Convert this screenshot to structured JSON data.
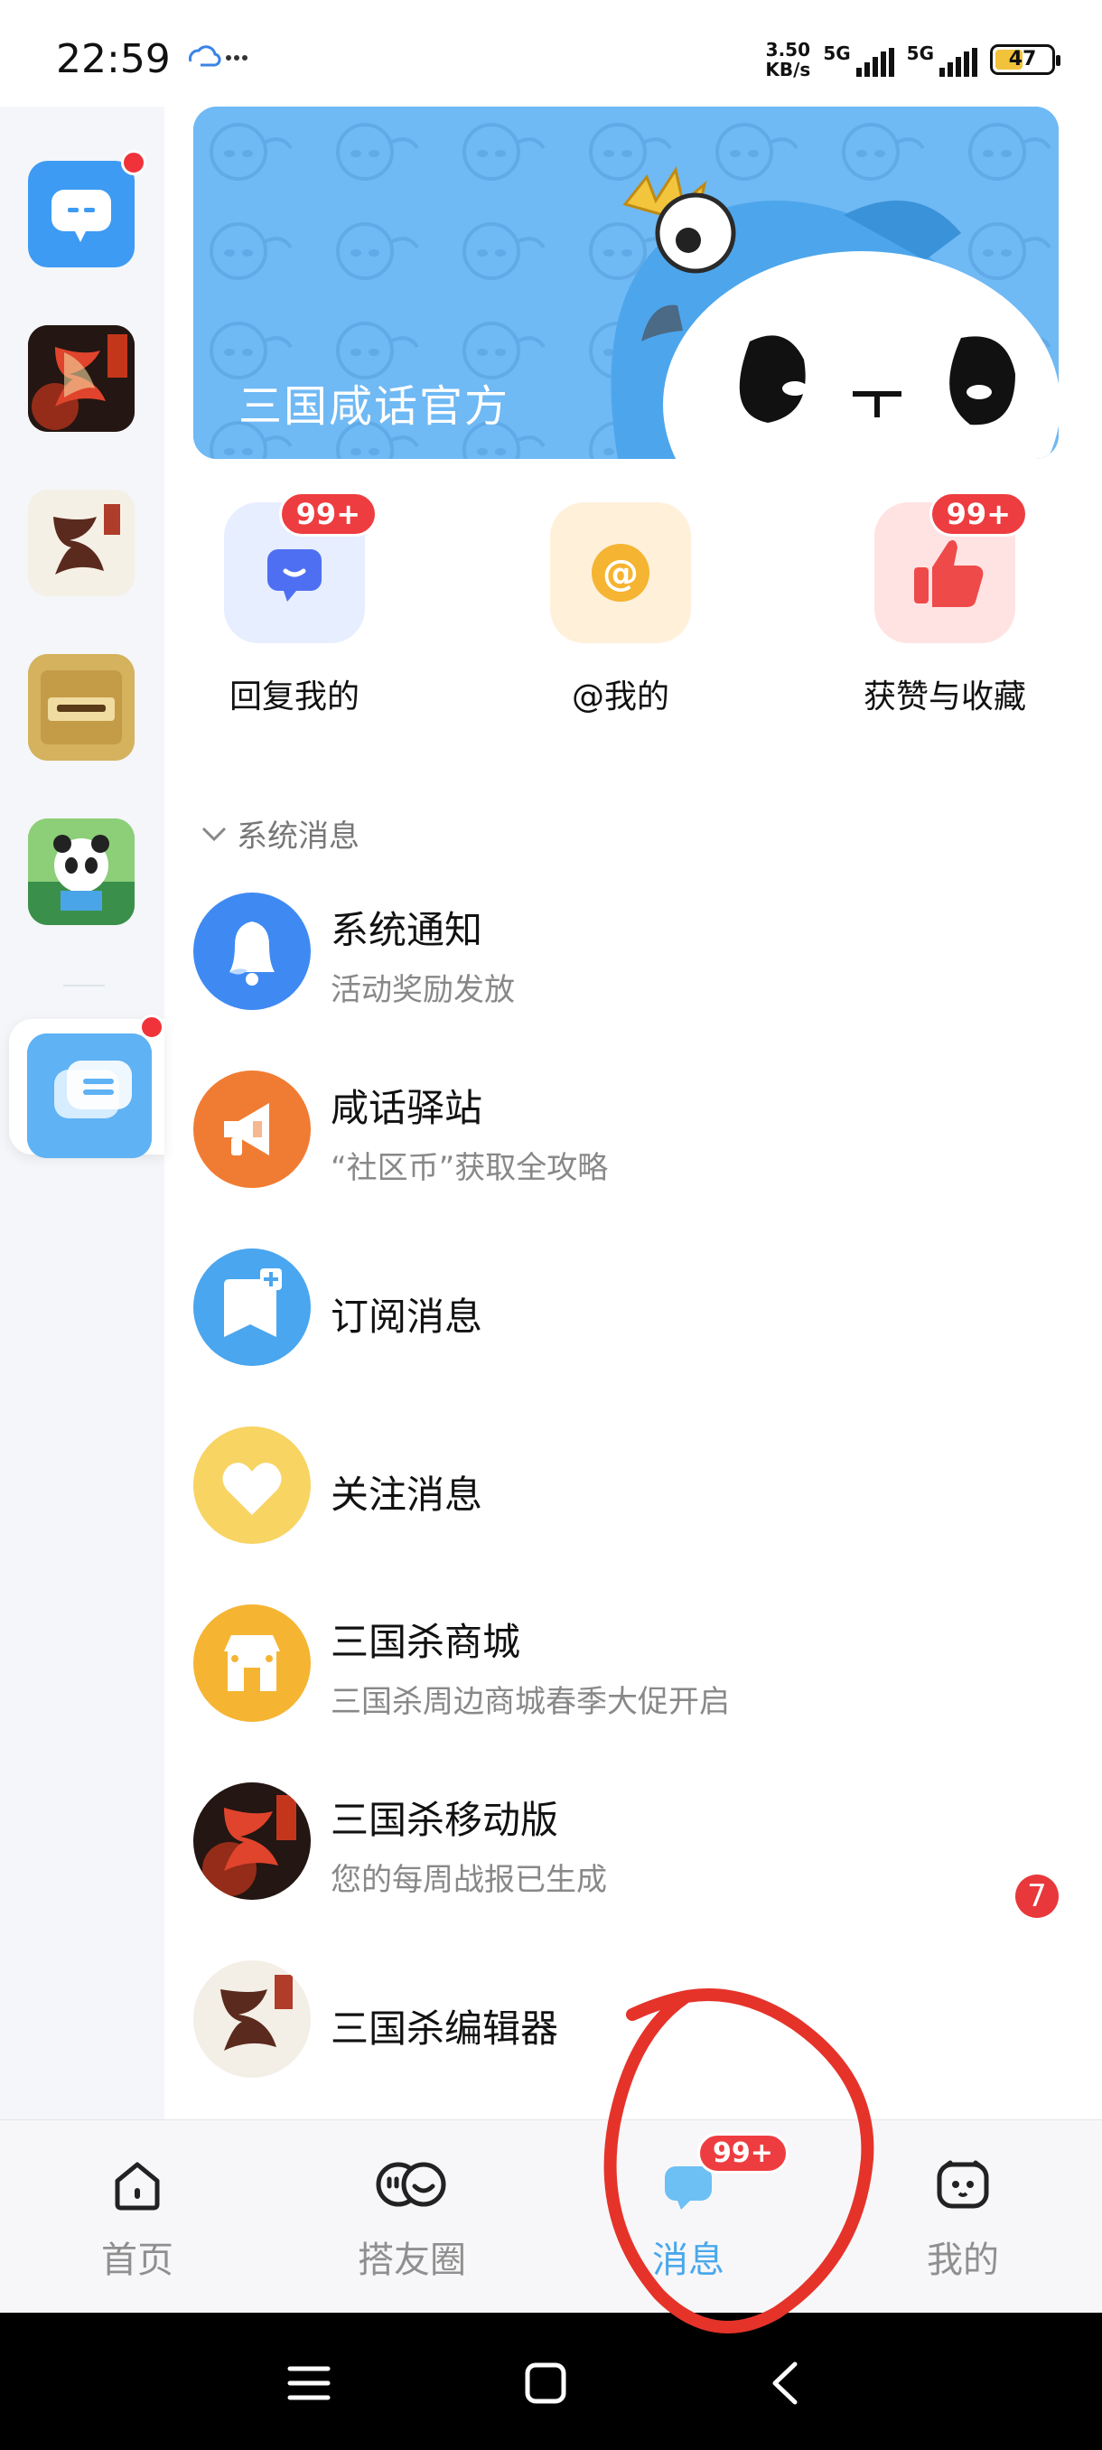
{
  "status_bar": {
    "time": "22:59",
    "speed_value": "3.50",
    "speed_unit": "KB/s",
    "network_1": "5G",
    "network_2": "5G",
    "battery": "47"
  },
  "sidebar": {
    "items": [
      {
        "name": "chat-app",
        "has_dot": true
      },
      {
        "name": "sanguosha-mobile",
        "has_dot": false
      },
      {
        "name": "sanguosha-editor",
        "has_dot": false
      },
      {
        "name": "collection-card",
        "has_dot": false
      },
      {
        "name": "panda-game",
        "has_dot": false
      },
      {
        "name": "messages-bubble",
        "has_dot": true,
        "active": true
      }
    ]
  },
  "banner": {
    "title": "三国咸话官方"
  },
  "quick_actions": [
    {
      "label": "回复我的",
      "badge": "99+",
      "icon": "reply-icon",
      "bg": "#e8efff"
    },
    {
      "label": "@我的",
      "badge": "",
      "icon": "at-icon",
      "bg": "#fff1dc"
    },
    {
      "label": "获赞与收藏",
      "badge": "99+",
      "icon": "thumbs-up-icon",
      "bg": "#ffe6e6"
    }
  ],
  "section": {
    "label": "系统消息"
  },
  "messages": [
    {
      "title": "系统通知",
      "subtitle": "活动奖励发放",
      "icon": "bell-icon",
      "color": "#3f8af2"
    },
    {
      "title": "咸话驿站",
      "subtitle": "“社区币”获取全攻略",
      "icon": "megaphone-icon",
      "color": "#f07c33"
    },
    {
      "title": "订阅消息",
      "subtitle": "",
      "icon": "bookmark-plus-icon",
      "color": "#4aa6ef"
    },
    {
      "title": "关注消息",
      "subtitle": "",
      "icon": "heart-icon",
      "color": "#f7cf55"
    },
    {
      "title": "三国杀商城",
      "subtitle": "三国杀周边商城春季大促开启",
      "icon": "store-icon",
      "color": "#f5b533"
    },
    {
      "title": "三国杀移动版",
      "subtitle": "您的每周战报已生成",
      "icon": "sanguosha-logo-icon",
      "color": "#2a1a12",
      "count": "7"
    },
    {
      "title": "三国杀编辑器",
      "subtitle": "",
      "icon": "sanguosha-editor-logo-icon",
      "color": "#f3efe6"
    }
  ],
  "bottom_nav": {
    "items": [
      {
        "label": "首页",
        "icon": "home-icon"
      },
      {
        "label": "搭友圈",
        "icon": "friends-icon"
      },
      {
        "label": "消息",
        "icon": "message-icon",
        "active": true,
        "badge": "99+"
      },
      {
        "label": "我的",
        "icon": "profile-icon"
      }
    ]
  },
  "colors": {
    "accent": "#4aa8ec",
    "badge_red": "#ee3d40",
    "annotation": "#e5332a"
  }
}
